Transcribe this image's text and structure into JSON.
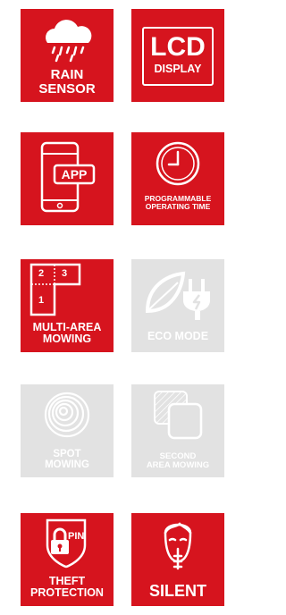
{
  "colors": {
    "accent": "#d6141e",
    "disabled": "#e2e2e2",
    "text": "#ffffff"
  },
  "features": [
    {
      "id": "rain",
      "label": "RAIN\nSENSOR",
      "active": true,
      "icon": "rain-cloud-icon"
    },
    {
      "id": "lcd",
      "label_big": "LCD",
      "label": "DISPLAY",
      "active": true,
      "icon": "lcd-display-icon"
    },
    {
      "id": "app",
      "label": "APP",
      "active": true,
      "icon": "smartphone-app-icon"
    },
    {
      "id": "prog",
      "label": "PROGRAMMABLE\nOPERATING TIME",
      "active": true,
      "icon": "clock-icon"
    },
    {
      "id": "multi",
      "label": "MULTI-AREA\nMOWING",
      "active": true,
      "icon": "multi-area-icon",
      "areas": [
        "2",
        "3",
        "1"
      ]
    },
    {
      "id": "eco",
      "label": "ECO MODE",
      "active": false,
      "icon": "eco-plug-icon"
    },
    {
      "id": "spot",
      "label": "SPOT\nMOWING",
      "active": false,
      "icon": "spot-spiral-icon"
    },
    {
      "id": "second",
      "label": "SECOND\nAREA MOWING",
      "active": false,
      "icon": "second-area-icon"
    },
    {
      "id": "theft",
      "label": "THEFT\nPROTECTION",
      "active": true,
      "icon": "pin-lock-icon",
      "pin_text": "PIN"
    },
    {
      "id": "silent",
      "label": "SILENT",
      "active": true,
      "icon": "silent-face-icon"
    }
  ]
}
